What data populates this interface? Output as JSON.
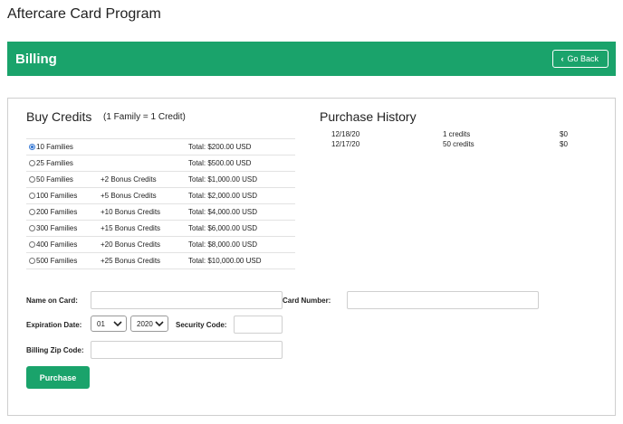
{
  "page": {
    "title": "Aftercare Card Program"
  },
  "header": {
    "title": "Billing",
    "go_back_label": "Go Back"
  },
  "buy_credits": {
    "title": "Buy Credits",
    "subtitle": "(1 Family = 1 Credit)",
    "selected_index": 0,
    "options": [
      {
        "label": "10 Families",
        "bonus": "",
        "total": "Total: $200.00 USD"
      },
      {
        "label": "25 Families",
        "bonus": "",
        "total": "Total: $500.00 USD"
      },
      {
        "label": "50 Families",
        "bonus": "+2 Bonus Credits",
        "total": "Total: $1,000.00 USD"
      },
      {
        "label": "100 Families",
        "bonus": "+5 Bonus Credits",
        "total": "Total: $2,000.00 USD"
      },
      {
        "label": "200 Families",
        "bonus": "+10 Bonus Credits",
        "total": "Total: $4,000.00 USD"
      },
      {
        "label": "300 Families",
        "bonus": "+15 Bonus Credits",
        "total": "Total: $6,000.00 USD"
      },
      {
        "label": "400 Families",
        "bonus": "+20 Bonus Credits",
        "total": "Total: $8,000.00 USD"
      },
      {
        "label": "500 Families",
        "bonus": "+25 Bonus Credits",
        "total": "Total: $10,000.00 USD"
      }
    ]
  },
  "purchase_history": {
    "title": "Purchase History",
    "rows": [
      {
        "date": "12/18/20",
        "credits": "1 credits",
        "amount": "$0"
      },
      {
        "date": "12/17/20",
        "credits": "50 credits",
        "amount": "$0"
      }
    ]
  },
  "form": {
    "name_on_card_label": "Name on Card:",
    "name_on_card_value": "",
    "card_number_label": "Card Number:",
    "card_number_value": "",
    "expiration_label": "Expiration Date:",
    "exp_month": "01",
    "exp_year": "2020",
    "security_code_label": "Security Code:",
    "security_code_value": "",
    "zip_label": "Billing Zip Code:",
    "zip_value": "",
    "purchase_label": "Purchase"
  },
  "colors": {
    "accent": "#1aa36b",
    "radio_selected": "#3a7bd5",
    "border": "#cfcfcf"
  }
}
